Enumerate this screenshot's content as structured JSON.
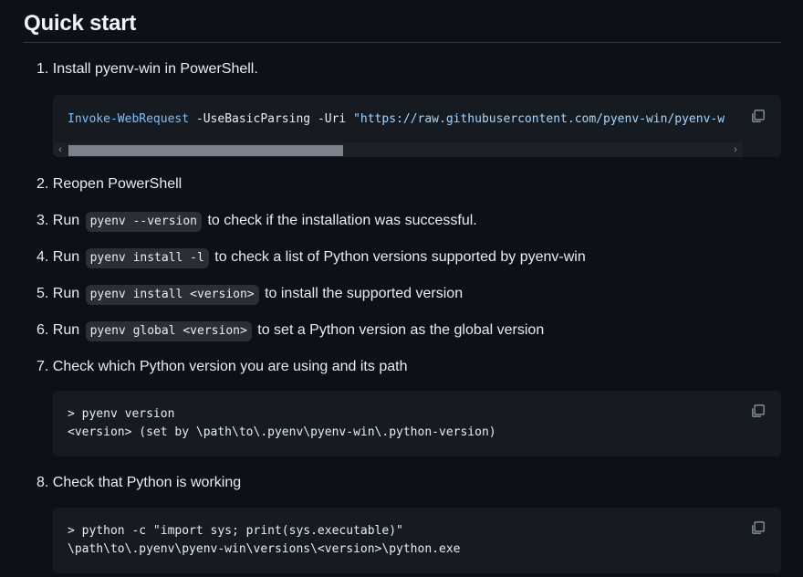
{
  "heading": "Quick start",
  "steps": [
    {
      "num": "1.",
      "text": "Install pyenv-win in PowerShell."
    },
    {
      "num": "2.",
      "text": "Reopen PowerShell"
    },
    {
      "num": "3.",
      "before": "Run",
      "code": "pyenv --version",
      "after": "to check if the installation was successful."
    },
    {
      "num": "4.",
      "before": "Run",
      "code": "pyenv install -l",
      "after": "to check a list of Python versions supported by pyenv-win"
    },
    {
      "num": "5.",
      "before": "Run",
      "code": "pyenv install <version>",
      "after": "to install the supported version"
    },
    {
      "num": "6.",
      "before": "Run",
      "code": "pyenv global <version>",
      "after": "to set a Python version as the global version"
    },
    {
      "num": "7.",
      "text": "Check which Python version you are using and its path"
    },
    {
      "num": "8.",
      "text": "Check that Python is working"
    }
  ],
  "code1": {
    "cmd": "Invoke-WebRequest",
    "args": " -UseBasicParsing -Uri ",
    "url": "\"https://raw.githubusercontent.com/pyenv-win/pyenv-w",
    "scroll_fraction": 0.4
  },
  "code2": {
    "line1": "> pyenv version",
    "line2": "<version> (set by \\path\\to\\.pyenv\\pyenv-win\\.python-version)"
  },
  "code3": {
    "line1": "> python -c \"import sys; print(sys.executable)\"",
    "line2": "\\path\\to\\.pyenv\\pyenv-win\\versions\\<version>\\python.exe"
  },
  "icons": {
    "copy": "copy-icon",
    "scroll_left": "chevron-left-icon",
    "scroll_right": "chevron-right-icon"
  },
  "colors": {
    "background": "#0d1117",
    "code_bg": "#161b22",
    "keyword": "#79c0ff",
    "string": "#a5d6ff"
  }
}
